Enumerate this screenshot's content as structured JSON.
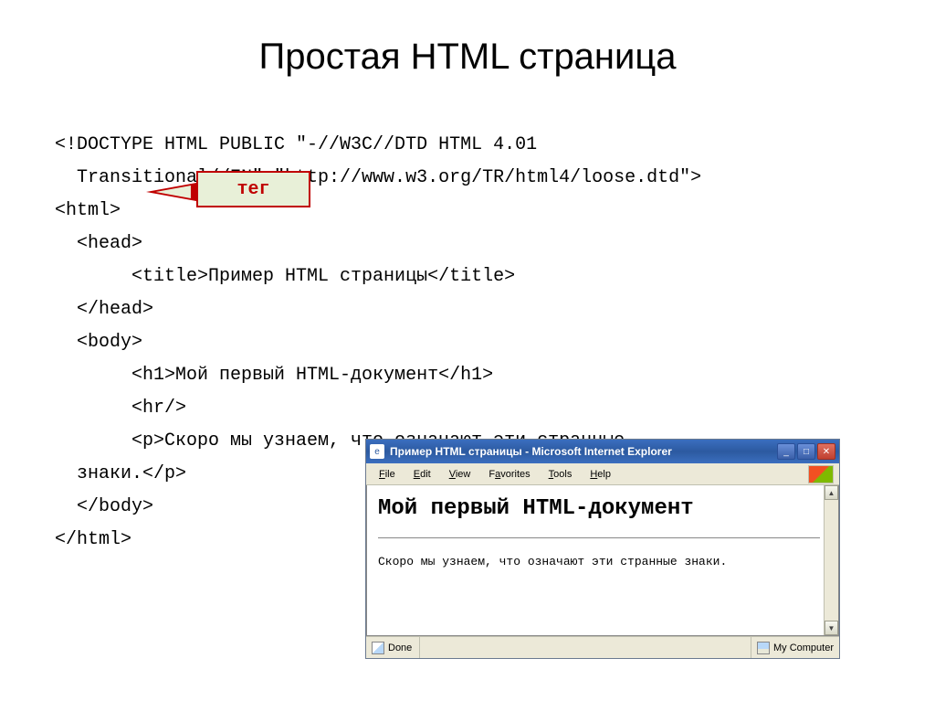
{
  "title": "Простая HTML страница",
  "code": {
    "l1a": "<!DOCTYPE HTML PUBLIC \"-//W3C//DTD HTML 4.01",
    "l1b": "  Transitional//EN\" \"http://www.w3.org/TR/html4/loose.dtd\">",
    "l2": "<html>",
    "l3": "  <head>",
    "l4": "       <title>Пример HTML страницы</title>",
    "l5": "  </head>",
    "l6": "  <body>",
    "l7": "       <h1>Мой первый HTML-документ</h1>",
    "l8": "       <hr/>",
    "l9a": "       <p>Скоро мы узнаем, что означают эти странные",
    "l9b": "  знаки.</p>",
    "l10": "  </body>",
    "l11": "</html>"
  },
  "annotation": "тег",
  "browser": {
    "title": "Пример HTML страницы - Microsoft Internet Explorer",
    "menu": {
      "file": "File",
      "edit": "Edit",
      "view": "View",
      "favorites": "Favorites",
      "tools": "Tools",
      "help": "Help"
    },
    "content": {
      "h1": "Мой первый HTML-документ",
      "p": "Скоро мы узнаем, что означают эти странные знаки."
    },
    "status": {
      "done": "Done",
      "location": "My Computer"
    },
    "buttons": {
      "min": "_",
      "max": "□",
      "close": "✕"
    },
    "scroll": {
      "up": "▲",
      "down": "▼"
    },
    "icon_glyph": "e"
  }
}
